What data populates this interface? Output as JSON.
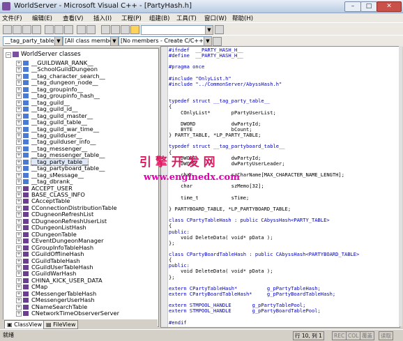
{
  "window": {
    "title": "WorldServer - Microsoft Visual C++ - [PartyHash.h]",
    "min_label": "–",
    "max_label": "□",
    "close_label": "✕"
  },
  "menu": [
    "文件(F)",
    "编辑(E)",
    "查看(V)",
    "插入(I)",
    "工程(P)",
    "组建(B)",
    "工具(T)",
    "窗口(W)",
    "帮助(H)"
  ],
  "toolbar": {
    "class_combo": "__tag_party_table__",
    "members_combo": "[All class members]",
    "func_combo": "[No members - Create C/C++ Memb"
  },
  "tree": {
    "root": "WorldServer classes",
    "items": [
      {
        "label": "__GUILDWAR_RANK__",
        "kind": "struct"
      },
      {
        "label": "__SchoolGuildDungeon",
        "kind": "struct"
      },
      {
        "label": "__tag_character_search__",
        "kind": "struct"
      },
      {
        "label": "__tag_dungeon_node__",
        "kind": "struct"
      },
      {
        "label": "__tag_groupinfo__",
        "kind": "struct"
      },
      {
        "label": "__tag_groupinfo_hash__",
        "kind": "struct"
      },
      {
        "label": "__tag_guild__",
        "kind": "struct"
      },
      {
        "label": "__tag_guild_id__",
        "kind": "struct"
      },
      {
        "label": "__tag_guild_master__",
        "kind": "struct"
      },
      {
        "label": "__tag_guild_table__",
        "kind": "struct"
      },
      {
        "label": "__tag_guild_war_time__",
        "kind": "struct"
      },
      {
        "label": "__tag_guilduser__",
        "kind": "struct"
      },
      {
        "label": "__tag_guilduser_info__",
        "kind": "struct"
      },
      {
        "label": "__tag_messenger__",
        "kind": "struct"
      },
      {
        "label": "__tag_messenger_table__",
        "kind": "struct"
      },
      {
        "label": "__tag_party_table__",
        "kind": "struct",
        "selected": true
      },
      {
        "label": "__tag_partyboard_table__",
        "kind": "struct"
      },
      {
        "label": "__tag_sMessage__",
        "kind": "struct"
      },
      {
        "label": "__tag_dbrank_",
        "kind": "struct"
      },
      {
        "label": "ACCEPT_USER",
        "kind": "class"
      },
      {
        "label": "BASE_CLASS_INFO",
        "kind": "class"
      },
      {
        "label": "CAcceptTable",
        "kind": "class"
      },
      {
        "label": "CConnectionDistributionTable",
        "kind": "class"
      },
      {
        "label": "CDugneonRefreshList",
        "kind": "class"
      },
      {
        "label": "CDugneonRefreshUserList",
        "kind": "class"
      },
      {
        "label": "CDungeonListHash",
        "kind": "class"
      },
      {
        "label": "CDungeonTable",
        "kind": "class"
      },
      {
        "label": "CEventDungeonManager",
        "kind": "class"
      },
      {
        "label": "CGroupInfoTableHash",
        "kind": "class"
      },
      {
        "label": "CGuildOfflineHash",
        "kind": "class"
      },
      {
        "label": "CGuildTableHash",
        "kind": "class"
      },
      {
        "label": "CGuildUserTableHash",
        "kind": "class"
      },
      {
        "label": "CGuildWarHash",
        "kind": "class"
      },
      {
        "label": "CHINA_KICK_USER_DATA",
        "kind": "class"
      },
      {
        "label": "CMap",
        "kind": "class"
      },
      {
        "label": "CMessengerTableHash",
        "kind": "class"
      },
      {
        "label": "CMessengerUserHash",
        "kind": "class"
      },
      {
        "label": "CNameSearchTable",
        "kind": "class"
      },
      {
        "label": "CNetworkTimeObserverServer",
        "kind": "class"
      }
    ]
  },
  "tabs": [
    "ClassView",
    "FileView"
  ],
  "code_lines": [
    {
      "text": "#ifndef  __PARTY_HASH_H__",
      "kw": true
    },
    {
      "text": "#define  __PARTY_HASH_H__",
      "kw": true
    },
    {
      "text": "",
      "kw": false
    },
    {
      "text": "#pragma once",
      "kw": true
    },
    {
      "text": "",
      "kw": false
    },
    {
      "text": "#include \"OnlyList.h\"",
      "kw": true
    },
    {
      "text": "#include \"../CommonServer/AbyssHash.h\"",
      "kw": true
    },
    {
      "text": "",
      "kw": false
    },
    {
      "text": "",
      "kw": false
    },
    {
      "text": "typedef struct __tag_party_table__",
      "kw": true
    },
    {
      "text": "{",
      "kw": false
    },
    {
      "text": "    COnlyList*       pPartyUserList;",
      "kw": false
    },
    {
      "text": "",
      "kw": false
    },
    {
      "text": "    DWORD            dwPartyId;",
      "kw": false
    },
    {
      "text": "    BYTE             bCount;",
      "kw": false
    },
    {
      "text": "} PARTY_TABLE, *LP_PARTY_TABLE;",
      "kw": false
    },
    {
      "text": "",
      "kw": false
    },
    {
      "text": "typedef struct __tag_partyboard_table__",
      "kw": true
    },
    {
      "text": "{",
      "kw": false
    },
    {
      "text": "    DWORD            dwPartyId;",
      "kw": false
    },
    {
      "text": "    DWORD            dwPartyUserLeader;",
      "kw": false
    },
    {
      "text": "",
      "kw": false
    },
    {
      "text": "    char             szCharName[MAX_CHARACTER_NAME_LENGTH];",
      "kw": false
    },
    {
      "text": "",
      "kw": false
    },
    {
      "text": "    char             szMemo[32];",
      "kw": false
    },
    {
      "text": "",
      "kw": false
    },
    {
      "text": "    time_t           sTime;",
      "kw": false
    },
    {
      "text": "",
      "kw": false
    },
    {
      "text": "} PARTYBOARD_TABLE, *LP_PARTYBOARD_TABLE;",
      "kw": false
    },
    {
      "text": "",
      "kw": false
    },
    {
      "text": "class CPartyTableHash : public CAbyssHash<PARTY_TABLE>",
      "kw": true
    },
    {
      "text": "{",
      "kw": false
    },
    {
      "text": "public:",
      "kw": true
    },
    {
      "text": "    void DeleteData( void* pData );",
      "kw": false
    },
    {
      "text": "};",
      "kw": false
    },
    {
      "text": "",
      "kw": false
    },
    {
      "text": "class CPartyBoardTableHash : public CAbyssHash<PARTYBOARD_TABLE>",
      "kw": true
    },
    {
      "text": "{",
      "kw": false
    },
    {
      "text": "public:",
      "kw": true
    },
    {
      "text": "    void DeleteData( void* pData );",
      "kw": false
    },
    {
      "text": "};",
      "kw": false
    },
    {
      "text": "",
      "kw": false
    },
    {
      "text": "extern CPartyTableHash*          g_pPartyTableHash;",
      "kw": true
    },
    {
      "text": "extern CPartyBoardTableHash*     g_pPartyBoardTableHash;",
      "kw": true
    },
    {
      "text": "",
      "kw": false
    },
    {
      "text": "extern STMPOOL_HANDLE       g_pPartyTablePool;",
      "kw": true
    },
    {
      "text": "extern STMPOOL_HANDLE       g_pPartyBoardTablePool;",
      "kw": true
    },
    {
      "text": "",
      "kw": false
    },
    {
      "text": "#endif",
      "kw": true
    }
  ],
  "watermark": {
    "line1": "引 擎 开 发 网",
    "line2": "www.enginedx.com"
  },
  "status": {
    "ready": "就绪",
    "position": "行 10, 列 1",
    "rec": "REC",
    "col": "COL",
    "ovr": "覆盖",
    "read": "读取"
  }
}
